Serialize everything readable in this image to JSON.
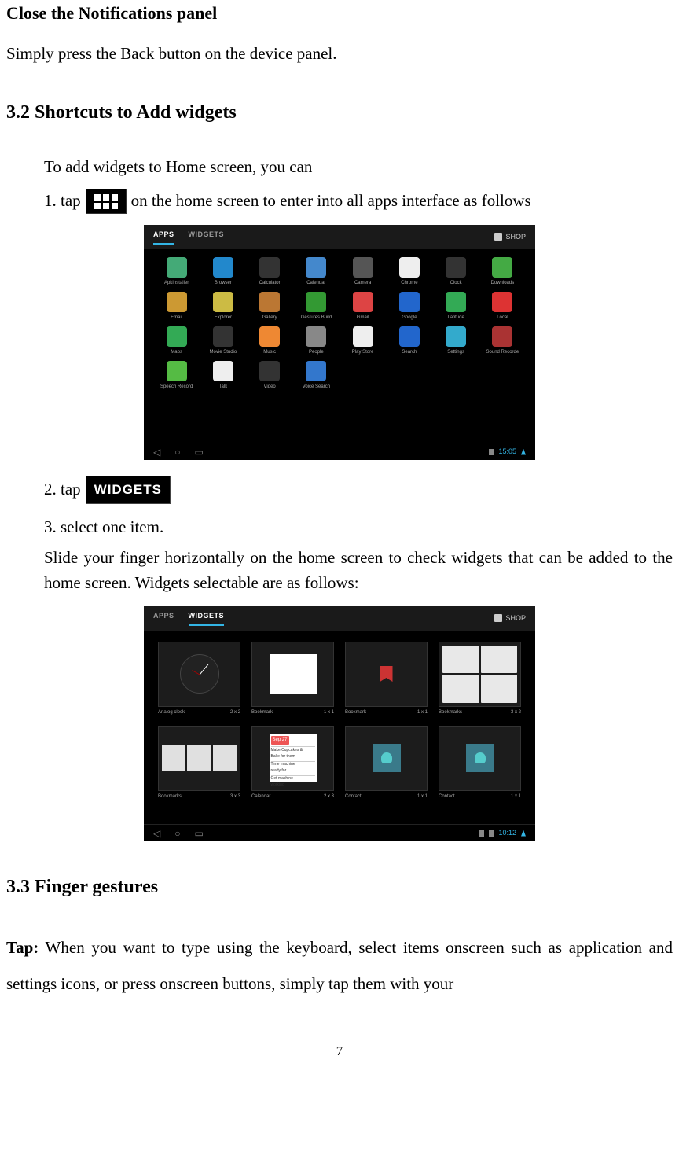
{
  "heading1": "Close the Notifications panel",
  "para1": "Simply press the Back button on the device panel.",
  "heading2": "3.2 Shortcuts to Add widgets",
  "para2": "To add widgets to Home screen, you can",
  "step1_before": "1. tap ",
  "step1_after": " on the home screen to enter into all apps interface as follows",
  "step2_before": "2. tap ",
  "widgets_label": "WIDGETS",
  "step3": "3. select one item.",
  "para3": "Slide your finger horizontally on the home screen to check widgets that can be added to the home screen. Widgets selectable are as follows:",
  "heading3": "3.3 Finger gestures",
  "para4_label": "Tap:",
  "para4": " When you want to type using the keyboard, select items onscreen such as application and settings icons, or press onscreen buttons, simply tap them with your",
  "page_number": "7",
  "screenshot1": {
    "tab_apps": "APPS",
    "tab_widgets": "WIDGETS",
    "shop": "SHOP",
    "time": "15:05",
    "apps": [
      {
        "label": "ApkInstaller",
        "bg": "#4a7"
      },
      {
        "label": "Browser",
        "bg": "#28c"
      },
      {
        "label": "Calculator",
        "bg": "#333"
      },
      {
        "label": "Calendar",
        "bg": "#48c"
      },
      {
        "label": "Camera",
        "bg": "#555"
      },
      {
        "label": "Chrome",
        "bg": "#eee"
      },
      {
        "label": "Clock",
        "bg": "#333"
      },
      {
        "label": "Downloads",
        "bg": "#4a4"
      },
      {
        "label": "Email",
        "bg": "#c93"
      },
      {
        "label": "Explorer",
        "bg": "#cb4"
      },
      {
        "label": "Gallery",
        "bg": "#b73"
      },
      {
        "label": "Gestures Build",
        "bg": "#393"
      },
      {
        "label": "Gmail",
        "bg": "#d44"
      },
      {
        "label": "Google",
        "bg": "#26c"
      },
      {
        "label": "Latitude",
        "bg": "#3a5"
      },
      {
        "label": "Local",
        "bg": "#d33"
      },
      {
        "label": "Maps",
        "bg": "#3a5"
      },
      {
        "label": "Movie Studio",
        "bg": "#333"
      },
      {
        "label": "Music",
        "bg": "#e83"
      },
      {
        "label": "People",
        "bg": "#888"
      },
      {
        "label": "Play Store",
        "bg": "#eee"
      },
      {
        "label": "Search",
        "bg": "#26c"
      },
      {
        "label": "Settings",
        "bg": "#3ac"
      },
      {
        "label": "Sound Recorde",
        "bg": "#a33"
      },
      {
        "label": "Speech Record",
        "bg": "#5b4"
      },
      {
        "label": "Talk",
        "bg": "#eee"
      },
      {
        "label": "Video",
        "bg": "#333"
      },
      {
        "label": "Voice Search",
        "bg": "#37c"
      }
    ]
  },
  "screenshot2": {
    "tab_apps": "APPS",
    "tab_widgets": "WIDGETS",
    "shop": "SHOP",
    "time": "10:12",
    "widgets": [
      {
        "label": "Analog clock",
        "size": "2 x 2"
      },
      {
        "label": "Bookmark",
        "size": "1 x 1"
      },
      {
        "label": "Bookmark",
        "size": "1 x 1"
      },
      {
        "label": "Bookmarks",
        "size": "3 x 2"
      },
      {
        "label": "Bookmarks",
        "size": "3 x 3"
      },
      {
        "label": "Calendar",
        "size": "2 x 3"
      },
      {
        "label": "Contact",
        "size": "1 x 1"
      },
      {
        "label": "Contact",
        "size": "1 x 1"
      }
    ]
  }
}
